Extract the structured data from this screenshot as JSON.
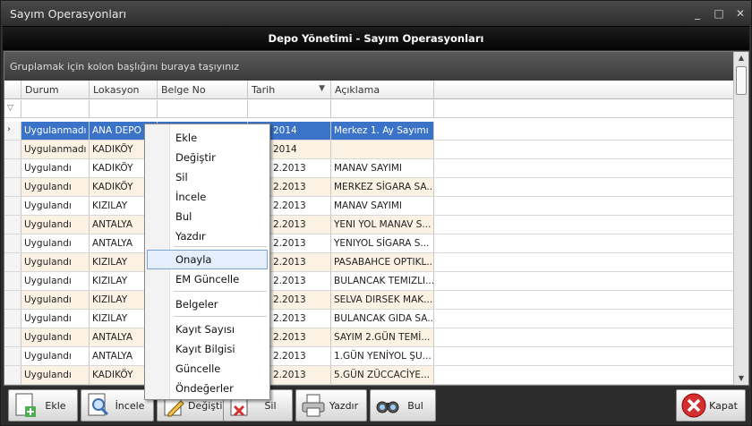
{
  "window": {
    "title": "Sayım Operasyonları",
    "controls": [
      "_",
      "□",
      "✕"
    ]
  },
  "header": {
    "title": "Depo Yönetimi - Sayım Operasyonları"
  },
  "group_panel": {
    "text": "Gruplamak için kolon başlığını buraya taşıyınız"
  },
  "columns": [
    "Durum",
    "Lokasyon",
    "Belge No",
    "Tarih",
    "Açıklama"
  ],
  "rows": [
    {
      "durum": "Uygulanmadı",
      "lokasyon": "ANA DEPO",
      "belge": "",
      "tarih": "2014",
      "aciklama": "Merkez 1. Ay Sayımı",
      "selected": true
    },
    {
      "durum": "Uygulanmadı",
      "lokasyon": "KADIKÖY",
      "belge": "",
      "tarih": "2014",
      "aciklama": ""
    },
    {
      "durum": "Uygulandı",
      "lokasyon": "KADIKÖY",
      "belge": "",
      "tarih": "2.2013",
      "aciklama": "MANAV SAYIMI"
    },
    {
      "durum": "Uygulandı",
      "lokasyon": "KADIKÖY",
      "belge": "",
      "tarih": "2.2013",
      "aciklama": "MERKEZ SİGARA SA..."
    },
    {
      "durum": "Uygulandı",
      "lokasyon": "KIZILAY",
      "belge": "",
      "tarih": "2.2013",
      "aciklama": "MANAV SAYIMI"
    },
    {
      "durum": "Uygulandı",
      "lokasyon": "ANTALYA",
      "belge": "",
      "tarih": "2.2013",
      "aciklama": "YENI YOL MANAV S..."
    },
    {
      "durum": "Uygulandı",
      "lokasyon": "ANTALYA",
      "belge": "",
      "tarih": "2.2013",
      "aciklama": "YENIYOL SİGARA S..."
    },
    {
      "durum": "Uygulandı",
      "lokasyon": "KIZILAY",
      "belge": "",
      "tarih": "2.2013",
      "aciklama": "PASABAHCE OPTIKL..."
    },
    {
      "durum": "Uygulandı",
      "lokasyon": "KIZILAY",
      "belge": "",
      "tarih": "2.2013",
      "aciklama": "BULANCAK TEMIZLI..."
    },
    {
      "durum": "Uygulandı",
      "lokasyon": "KIZILAY",
      "belge": "",
      "tarih": "2.2013",
      "aciklama": "SELVA DIRSEK MAK..."
    },
    {
      "durum": "Uygulandı",
      "lokasyon": "KIZILAY",
      "belge": "",
      "tarih": "2.2013",
      "aciklama": "BULANCAK GIDA SA..."
    },
    {
      "durum": "Uygulandı",
      "lokasyon": "ANTALYA",
      "belge": "",
      "tarih": "2.2013",
      "aciklama": "SAYIM 2.GÜN TEMİ..."
    },
    {
      "durum": "Uygulandı",
      "lokasyon": "ANTALYA",
      "belge": "",
      "tarih": "2.2013",
      "aciklama": "1.GÜN YENİYOL ŞU..."
    },
    {
      "durum": "Uygulandı",
      "lokasyon": "KADIKÖY",
      "belge": "",
      "tarih": "2.2013",
      "aciklama": "5.GÜN ZÜCCACİYE..."
    }
  ],
  "context_menu": {
    "items": [
      "Ekle",
      "Değiştir",
      "Sil",
      "İncele",
      "Bul",
      "Yazdır",
      "Onayla",
      "EM Güncelle",
      "Belgeler",
      "Kayıt Sayısı",
      "Kayıt Bilgisi",
      "Güncelle",
      "Öndeğerler"
    ],
    "highlighted": "Onayla"
  },
  "toolbar": {
    "ekle": "Ekle",
    "incele": "İncele",
    "degistir": "Değiştir",
    "sil": "Sil",
    "yazdir": "Yazdır",
    "bul": "Bul",
    "kapat": "Kapat"
  },
  "colors": {
    "selection": "#3a73c8",
    "alt_row": "#fbf2e3",
    "highlight_menu": "#e4eefc"
  }
}
